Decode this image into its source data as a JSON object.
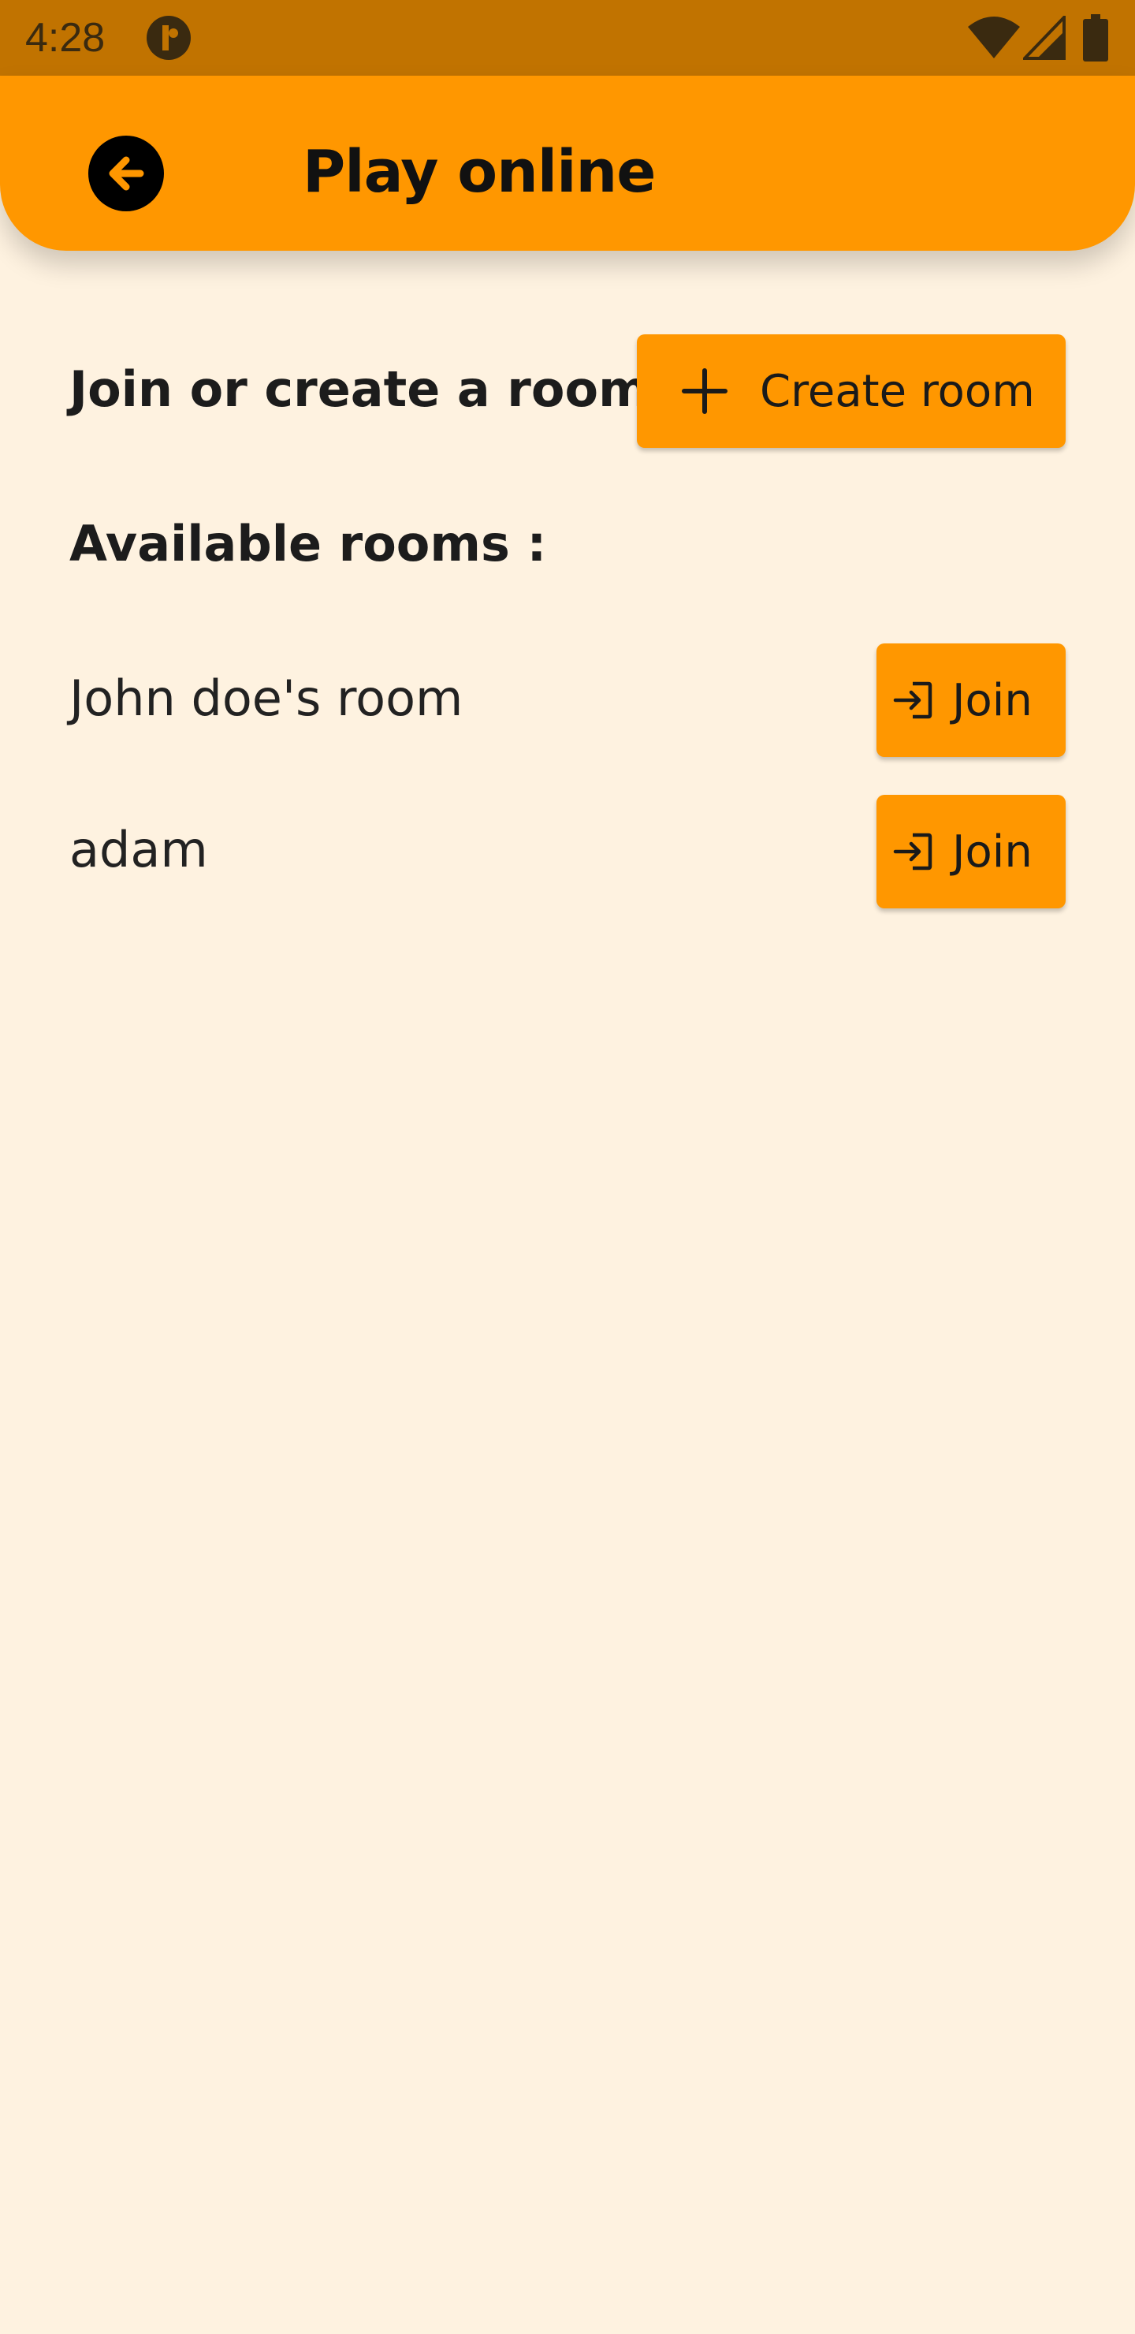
{
  "status_bar": {
    "time": "4:28"
  },
  "app_bar": {
    "title": "Play online"
  },
  "header": {
    "title": "Join or create a room",
    "create_label": "Create room"
  },
  "rooms": {
    "heading": "Available rooms :",
    "items": [
      {
        "name": "John doe's room",
        "join_label": "Join"
      },
      {
        "name": "adam",
        "join_label": "Join"
      }
    ]
  },
  "colors": {
    "status_bar": "#C17300",
    "app_bar": "#FF9700",
    "background": "#FEF2E0",
    "button": "#FF9700"
  }
}
